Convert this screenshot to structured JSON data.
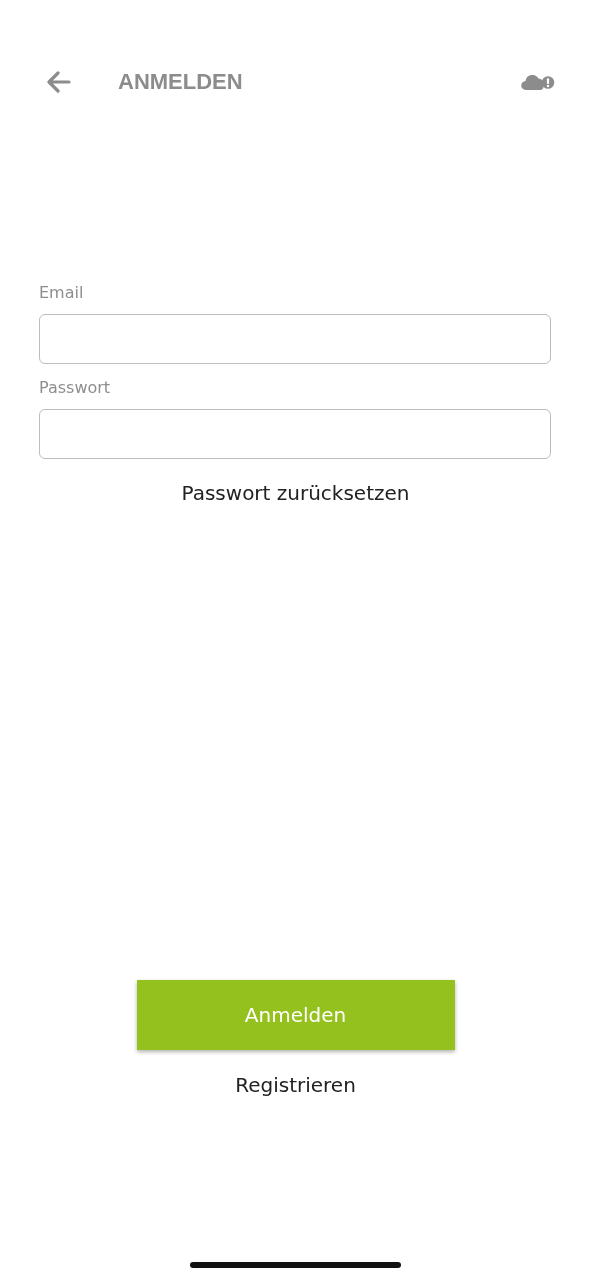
{
  "header": {
    "title": "ANMELDEN"
  },
  "fields": [
    {
      "label": "Email"
    },
    {
      "label": "Passwort"
    }
  ],
  "reset_link": "Passwort zurücksetzen",
  "login_button": "Anmelden",
  "register_link": "Registrieren"
}
